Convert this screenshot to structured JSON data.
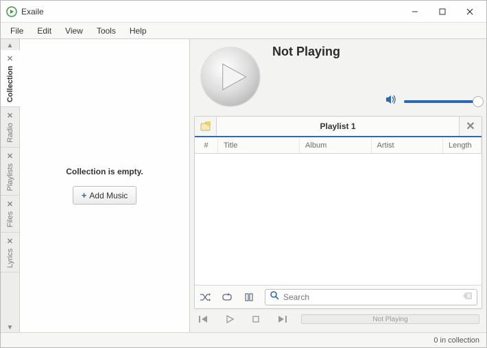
{
  "window": {
    "title": "Exaile"
  },
  "menu": {
    "file": "File",
    "edit": "Edit",
    "view": "View",
    "tools": "Tools",
    "help": "Help"
  },
  "sidebar": {
    "tabs": [
      {
        "id": "collection",
        "label": "Collection",
        "active": true
      },
      {
        "id": "radio",
        "label": "Radio",
        "active": false
      },
      {
        "id": "playlists",
        "label": "Playlists",
        "active": false
      },
      {
        "id": "files",
        "label": "Files",
        "active": false
      },
      {
        "id": "lyrics",
        "label": "Lyrics",
        "active": false
      }
    ]
  },
  "collection_panel": {
    "empty_message": "Collection is empty.",
    "add_button": "Add Music"
  },
  "now_playing": {
    "title": "Not Playing"
  },
  "volume": {
    "level_percent": 100
  },
  "playlist": {
    "tab_label": "Playlist 1",
    "columns": {
      "num": "#",
      "title": "Title",
      "album": "Album",
      "artist": "Artist",
      "length": "Length"
    },
    "search_placeholder": "Search"
  },
  "transport": {
    "progress_label": "Not Playing"
  },
  "status": {
    "text": "0 in collection"
  },
  "icons": {
    "speaker": "speaker-icon",
    "shuffle": "shuffle-icon",
    "repeat": "repeat-icon",
    "dynamic": "dynamic-icon",
    "magnifier": "search-icon",
    "newtab": "new-tab-icon"
  }
}
